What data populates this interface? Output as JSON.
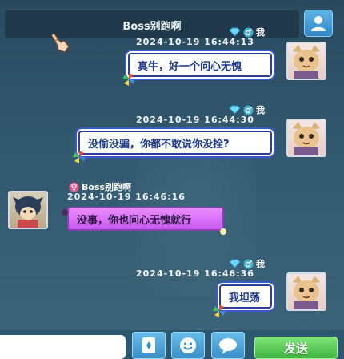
{
  "header": {
    "title": "Boss别跑啊",
    "profile_icon": "person-icon",
    "accent": "#3a9bd9"
  },
  "messages": [
    {
      "sender": "我",
      "timestamp": "2024-10-19   16:44:13",
      "text": "真牛，好一个问心无愧",
      "mine": true
    },
    {
      "sender": "我",
      "timestamp": "2024-10-19   16:44:30",
      "text": "没偷没骗，你都不敢说你没拴?",
      "mine": true
    },
    {
      "sender": "Boss别跑啊",
      "timestamp": "2024-10-19   16:46:16",
      "text": "没事，你也问心无愧就行",
      "mine": false
    },
    {
      "sender": "我",
      "timestamp": "2024-10-19   16:46:36",
      "text": "我坦荡",
      "mine": true
    }
  ],
  "composer": {
    "input_value": "",
    "send_label": "发送",
    "send_color": "#4cc24a",
    "icons": [
      "card-icon",
      "emoji-icon",
      "speech-bubble-icon"
    ]
  }
}
